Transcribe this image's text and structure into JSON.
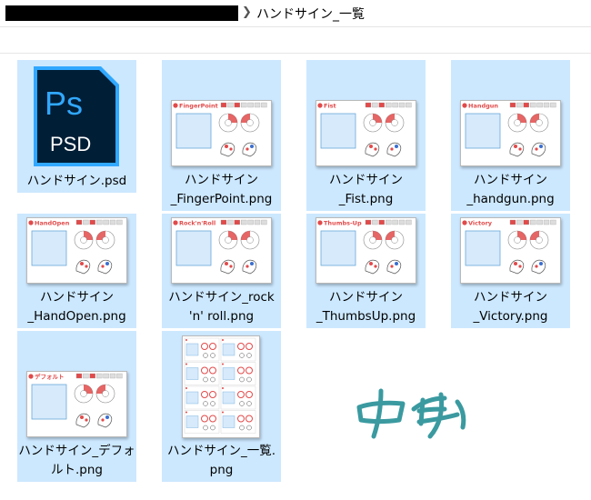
{
  "breadcrumb": {
    "current_folder": "ハンドサイン_一覧"
  },
  "files": [
    {
      "name_line1": "ハンドサイン.psd",
      "name_line2": "",
      "type": "psd",
      "icon": "photoshop-icon",
      "icon_text_top": "Ps",
      "icon_text_bottom": "PSD"
    },
    {
      "name_line1": "ハンドサイン",
      "name_line2": "_FingerPoint.png",
      "type": "png",
      "thumb_title": "FingerPoint"
    },
    {
      "name_line1": "ハンドサイン",
      "name_line2": "_Fist.png",
      "type": "png",
      "thumb_title": "Fist"
    },
    {
      "name_line1": "ハンドサイン",
      "name_line2": "_handgun.png",
      "type": "png",
      "thumb_title": "Handgun"
    },
    {
      "name_line1": "ハンドサイン",
      "name_line2": "_HandOpen.png",
      "type": "png",
      "thumb_title": "HandOpen"
    },
    {
      "name_line1": "ハンドサイン_rock",
      "name_line2": "'n' roll.png",
      "type": "png",
      "thumb_title": "Rock'n'Roll"
    },
    {
      "name_line1": "ハンドサイン",
      "name_line2": "_ThumbsUp.png",
      "type": "png",
      "thumb_title": "Thumbs-Up"
    },
    {
      "name_line1": "ハンドサイン",
      "name_line2": "_Victory.png",
      "type": "png",
      "thumb_title": "Victory"
    },
    {
      "name_line1": "ハンドサイン_デフォ",
      "name_line2": "ルト.png",
      "type": "png",
      "thumb_title": "デフォルト"
    },
    {
      "name_line1": "ハンドサイン_一覧.",
      "name_line2": "png",
      "type": "png-grid",
      "thumb_title": ""
    }
  ],
  "colors": {
    "selection": "#cce8ff",
    "ps_bg": "#001e36",
    "ps_blue": "#31a8ff",
    "thumb_red": "#e24a4a"
  }
}
